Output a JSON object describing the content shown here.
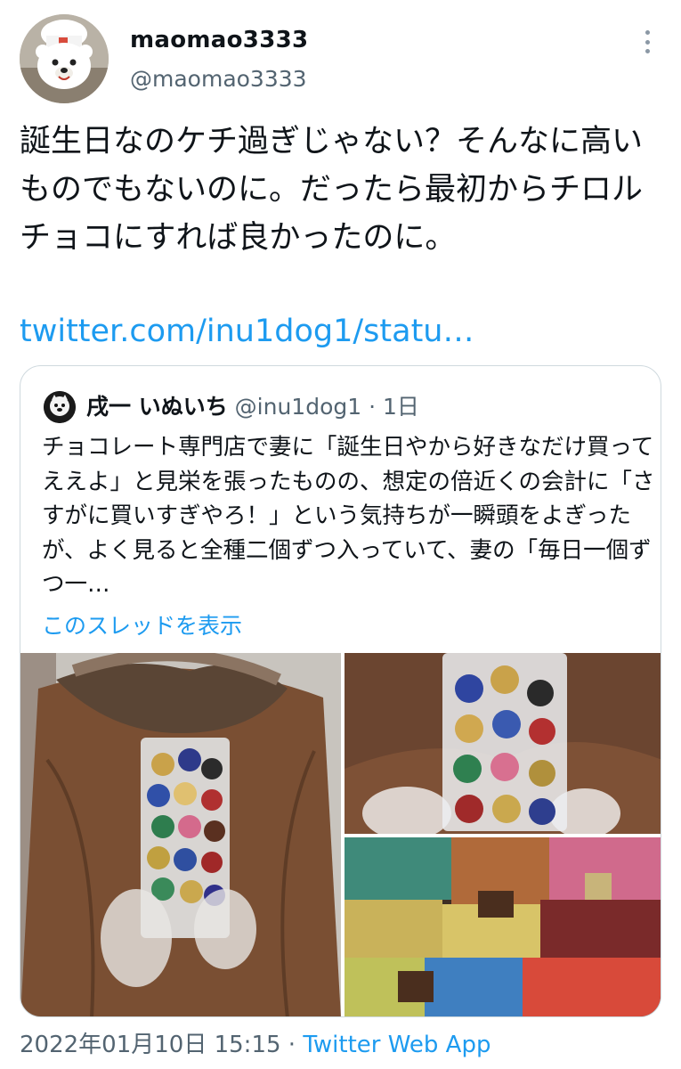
{
  "author": {
    "name": "maomao3333",
    "handle": "@maomao3333",
    "avatar_icon": "polar-bear-chef-avatar"
  },
  "tweet": {
    "text": "誕生日なのケチ過ぎじゃない？そんなに高いものでもないのに。だったら最初からチロルチョコにすれば良かったのに。",
    "link": "twitter.com/inu1dog1/statu…",
    "link_color": "#1d9bf0"
  },
  "quote": {
    "author_name": "戌一 いぬいち",
    "author_handle": "@inu1dog1",
    "time": "1日",
    "text": "チョコレート専門店で妻に「誕生日やから好きなだけ買ってええよ」と見栄を張ったものの、想定の倍近くの会計に「さすがに買いすぎやろ！」という気持ちが一瞬頭をよぎったが、よく見ると全種二個ずつ入っていて、妻の「毎日一個ずつ一…",
    "show_thread": "このスレッドを表示",
    "images": [
      "chocolate-bag-held-photo",
      "chocolate-bag-closeup-photo",
      "chocolate-store-display-photo"
    ]
  },
  "footer": {
    "timestamp": "2022年01月10日 15:15",
    "separator": " · ",
    "source": "Twitter Web App"
  },
  "colors": {
    "text": "#0f1419",
    "secondary": "#536471",
    "accent": "#1d9bf0",
    "border": "#cfd9de"
  }
}
